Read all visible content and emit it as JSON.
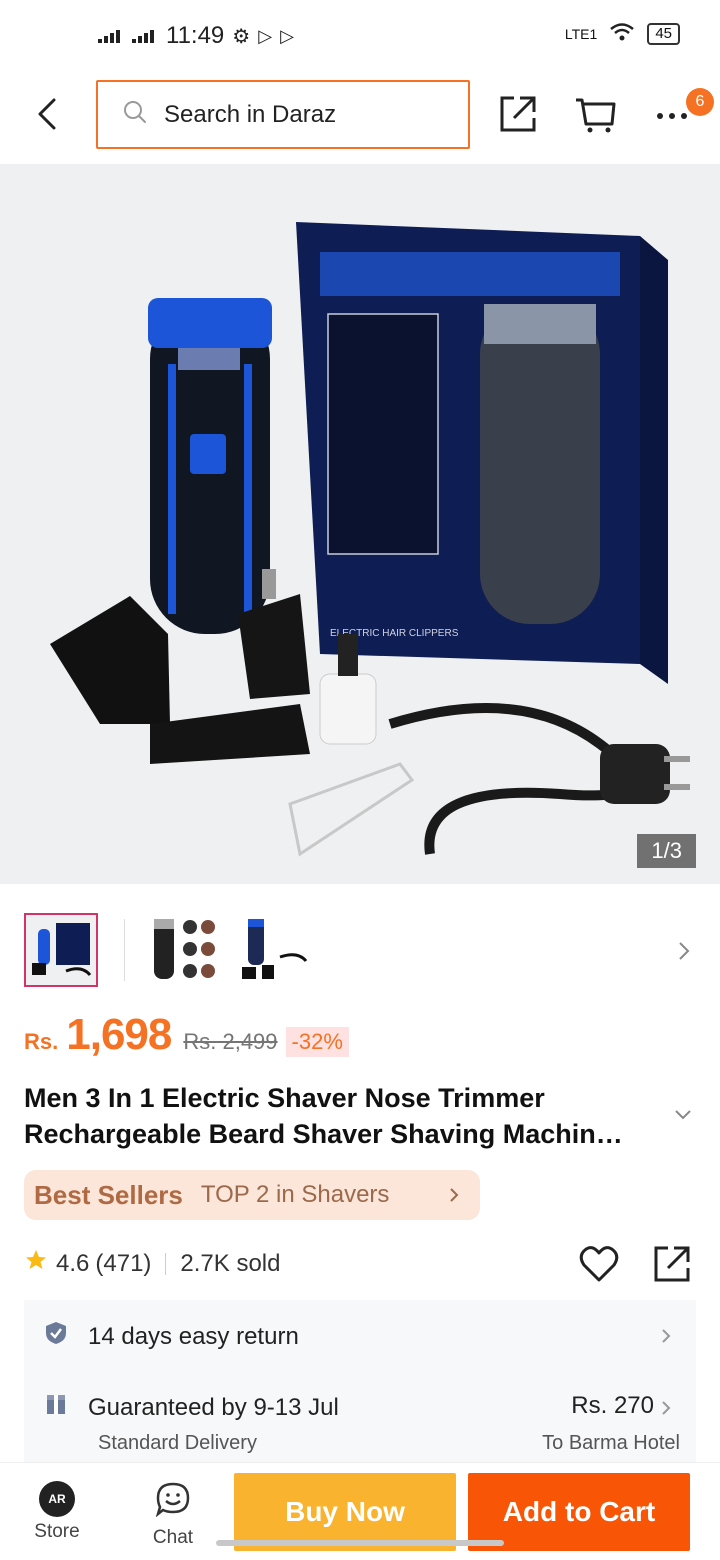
{
  "status_bar": {
    "time": "11:49",
    "battery": "45",
    "network": "LTE1"
  },
  "search": {
    "placeholder": "Search in Daraz"
  },
  "cart_badge": "6",
  "gallery": {
    "counter": "1/3"
  },
  "product": {
    "currency": "Rs.",
    "price": "1,698",
    "original_price": "Rs. 2,499",
    "discount": "-32%",
    "title": "Men 3 In 1 Electric Shaver Nose Trimmer Rechargeable Beard Shaver Shaving Machin…"
  },
  "best_sellers": {
    "label": "Best Sellers",
    "text": "TOP 2 in Shavers"
  },
  "rating": {
    "score": "4.6",
    "count": "(471)",
    "sold": "2.7K sold"
  },
  "return_policy": "14 days easy return",
  "delivery": {
    "guarantee": "Guaranteed by 9-13 Jul",
    "fee": "Rs. 270",
    "type": "Standard Delivery",
    "destination": "To Barma Hotel"
  },
  "bottom_bar": {
    "store_label": "Store",
    "store_logo": "AR",
    "chat_label": "Chat",
    "buy_now": "Buy Now",
    "add_to_cart": "Add to Cart"
  },
  "colors": {
    "accent": "#f57224",
    "buy_now": "#f9b32f",
    "add_to_cart": "#f85606"
  },
  "icons": [
    "back-icon",
    "search-icon",
    "share-icon",
    "cart-icon",
    "more-icon",
    "chevron-right-icon",
    "star-icon",
    "heart-icon",
    "shield-icon",
    "delivery-box-icon",
    "chat-icon"
  ]
}
